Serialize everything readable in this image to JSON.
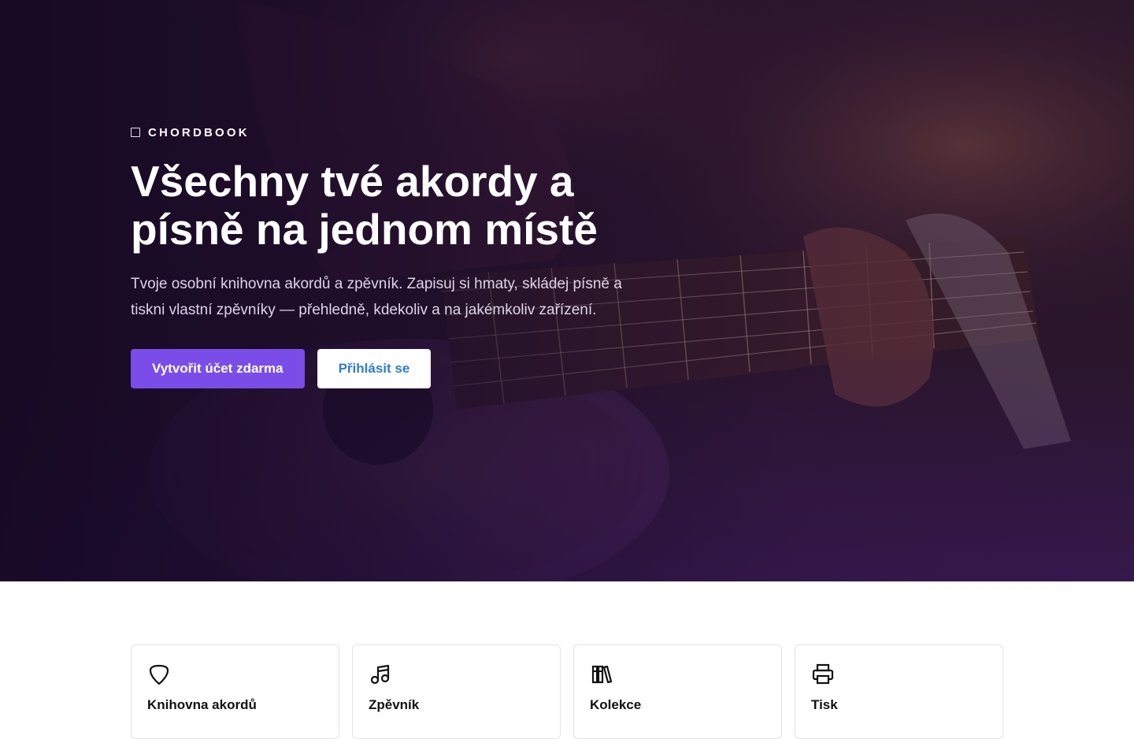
{
  "hero": {
    "brand": "CHORDBOOK",
    "brand_icon": "guitar-icon",
    "title": "Všechny tvé akordy a písně na jednom místě",
    "description": "Tvoje osobní knihovna akordů a zpěvník. Zapisuj si hmaty, skládej písně a tiskni vlastní zpěvníky — přehledně, kdekoliv a na jakémkoliv zařízení.",
    "primary_button": "Vytvořit účet zdarma",
    "secondary_button": "Přihlásit se"
  },
  "features": [
    {
      "title": "Knihovna akordů",
      "icon": "guitar-pick-icon"
    },
    {
      "title": "Zpěvník",
      "icon": "music-notes-icon"
    },
    {
      "title": "Kolekce",
      "icon": "books-icon"
    },
    {
      "title": "Tisk",
      "icon": "printer-icon"
    }
  ],
  "colors": {
    "accent": "#7b4de8",
    "link": "#2f7bd6",
    "hero_dark": "#1a0d22"
  }
}
